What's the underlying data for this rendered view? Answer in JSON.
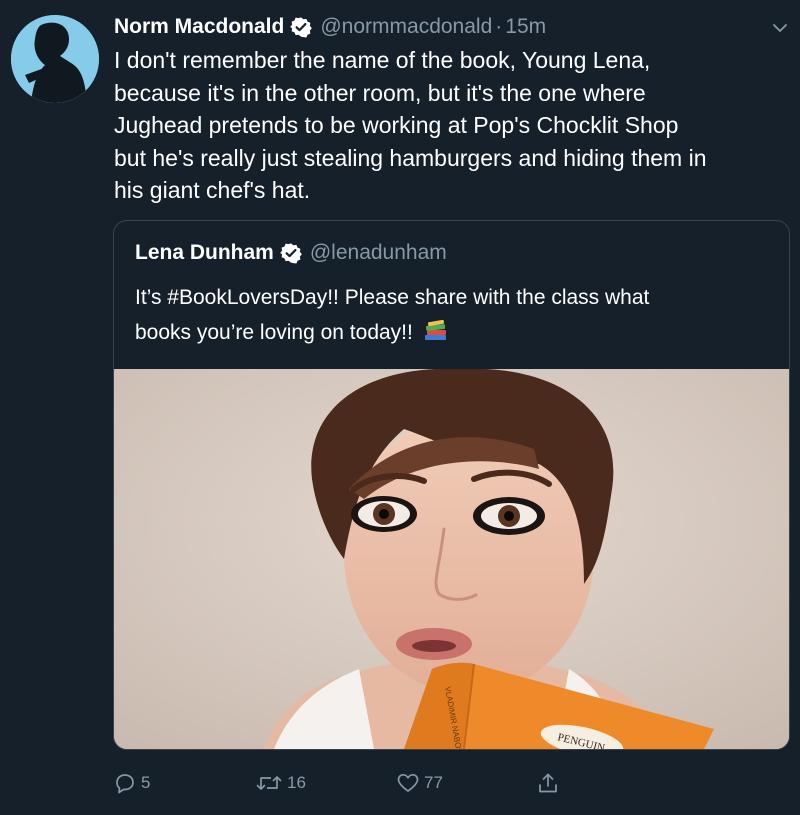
{
  "tweet": {
    "author": {
      "name": "Norm Macdonald",
      "handle": "@normmacdonald",
      "verified": true,
      "avatar_icon": "avatar-silhouette"
    },
    "separator": "·",
    "timestamp": "15m",
    "text": "I don't remember the name of the book, Young Lena,\nbecause it's in the other room, but it's the one where\nJughead pretends to be working at Pop's Chocklit Shop\nbut he's really just stealing hamburgers and hiding them in\nhis giant chef's hat.",
    "quoted": {
      "author": {
        "name": "Lena Dunham",
        "handle": "@lenadunham",
        "verified": true
      },
      "text_line1": "It’s #BookLoversDay!! Please share with the class what",
      "text_line2": "books you’re loving on today!!",
      "emoji": "books-emoji",
      "image": {
        "book_cover_text": "PENGUIN",
        "book_spine_text": "VLADIMIR NABOKOV"
      }
    },
    "actions": {
      "reply_count": "5",
      "retweet_count": "16",
      "like_count": "77"
    }
  },
  "colors": {
    "background": "#15202b",
    "secondary_text": "#8899a6",
    "border": "#38444d",
    "verified_badge": "#ffffff",
    "book_orange": "#ef8a2a"
  }
}
